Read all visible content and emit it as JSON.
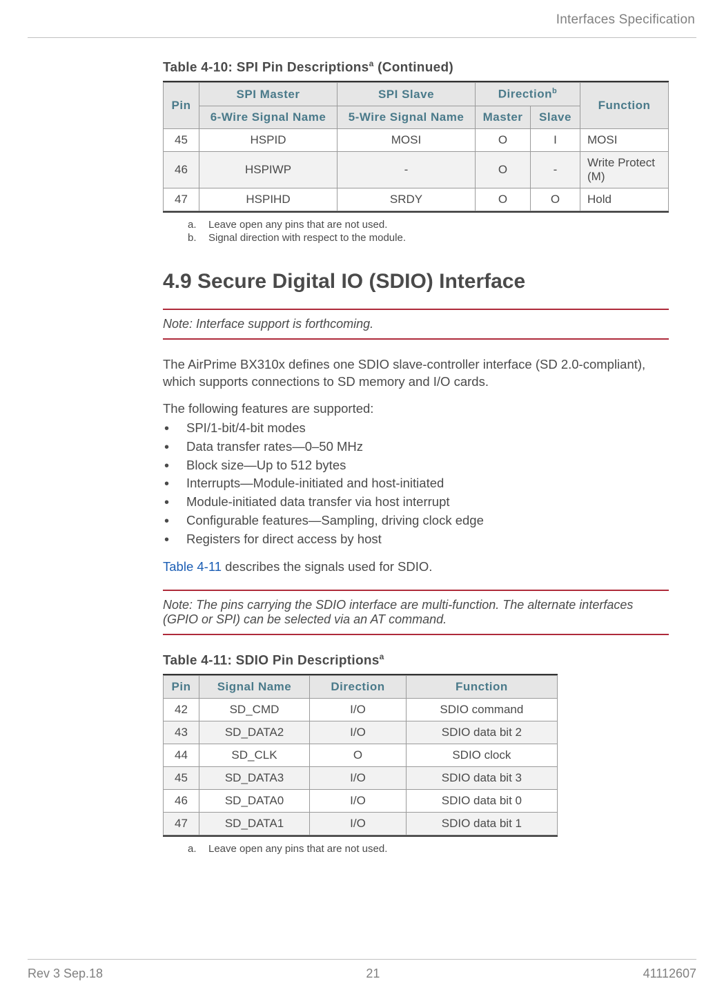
{
  "header": {
    "section_title": "Interfaces Specification"
  },
  "table_spi": {
    "caption_prefix": "Table 4-10:  SPI Pin Descriptions",
    "caption_sup": "a",
    "caption_suffix": " (Continued)",
    "head_top": {
      "spi_master": "SPI Master",
      "spi_slave": "SPI Slave",
      "direction": "Direction",
      "direction_sup": "b"
    },
    "head_bottom": {
      "pin": "Pin",
      "six_wire": "6-Wire Signal Name",
      "five_wire": "5-Wire Signal Name",
      "master": "Master",
      "slave": "Slave",
      "function": "Function"
    },
    "rows": [
      {
        "pin": "45",
        "six": "HSPID",
        "five": "MOSI",
        "master": "O",
        "slave": "I",
        "func": "MOSI"
      },
      {
        "pin": "46",
        "six": "HSPIWP",
        "five": "-",
        "master": "O",
        "slave": "-",
        "func": "Write Protect (M)"
      },
      {
        "pin": "47",
        "six": "HSPIHD",
        "five": "SRDY",
        "master": "O",
        "slave": "O",
        "func": "Hold"
      }
    ],
    "footnotes": [
      {
        "label": "a.",
        "text": "Leave open any pins that are not used."
      },
      {
        "label": "b.",
        "text": "Signal direction with respect to the module."
      }
    ]
  },
  "section": {
    "heading": "4.9 Secure Digital IO (SDIO) Interface"
  },
  "note1": {
    "label": "Note:",
    "text": "Interface support is forthcoming."
  },
  "para1": "The AirPrime BX310x defines one SDIO slave-controller interface (SD 2.0-compliant), which supports connections to SD memory and I/O cards.",
  "para2": "The following features are supported:",
  "bullets": [
    "SPI/1-bit/4-bit modes",
    "Data transfer rates—0–50 MHz",
    "Block size—Up to 512 bytes",
    "Interrupts—Module-initiated and host-initiated",
    "Module-initiated data transfer via host interrupt",
    "Configurable features—Sampling, driving clock edge",
    "Registers for direct access by host"
  ],
  "xref_sentence": {
    "link": "Table 4-11",
    "rest": " describes the signals used for SDIO."
  },
  "note2": {
    "label": "Note:",
    "text": "The pins carrying the SDIO interface are multi-function. The alternate interfaces (GPIO or SPI) can be selected via an AT command."
  },
  "table_sdio": {
    "caption_prefix": "Table 4-11:  SDIO Pin Descriptions",
    "caption_sup": "a",
    "head": {
      "pin": "Pin",
      "signal": "Signal Name",
      "direction": "Direction",
      "function": "Function"
    },
    "rows": [
      {
        "pin": "42",
        "signal": "SD_CMD",
        "dir": "I/O",
        "func": "SDIO command"
      },
      {
        "pin": "43",
        "signal": "SD_DATA2",
        "dir": "I/O",
        "func": "SDIO data bit 2"
      },
      {
        "pin": "44",
        "signal": "SD_CLK",
        "dir": "O",
        "func": "SDIO clock"
      },
      {
        "pin": "45",
        "signal": "SD_DATA3",
        "dir": "I/O",
        "func": "SDIO data bit 3"
      },
      {
        "pin": "46",
        "signal": "SD_DATA0",
        "dir": "I/O",
        "func": "SDIO data bit 0"
      },
      {
        "pin": "47",
        "signal": "SD_DATA1",
        "dir": "I/O",
        "func": "SDIO data bit 1"
      }
    ],
    "footnotes": [
      {
        "label": "a.",
        "text": "Leave open any pins that are not used."
      }
    ]
  },
  "footer": {
    "left": "Rev 3  Sep.18",
    "center": "21",
    "right": "41112607"
  }
}
